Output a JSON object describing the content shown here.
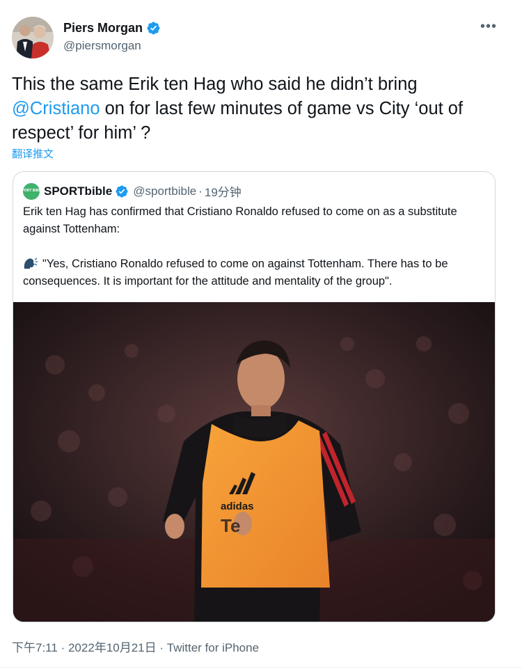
{
  "author": {
    "name": "Piers Morgan",
    "handle": "@piersmorgan",
    "verified": true,
    "avatar_icon": "avatar-photo"
  },
  "tweet": {
    "text_before": "This the same Erik ten Hag who said he didn’t bring ",
    "mention": "@Cristiano",
    "text_after": " on for last few minutes of game vs City ‘out of respect’ for him’ ?",
    "translate_label": "翻译推文"
  },
  "quoted": {
    "name": "SPORTbible",
    "handle": "@sportbible",
    "separator": "·",
    "time": "19分钟",
    "avatar_text": "SPORT BIBLE",
    "paragraph1": "Erik ten Hag has confirmed that Cristiano Ronaldo refused to come on as a substitute against Tottenham:",
    "paragraph2": "\"Yes, Cristiano Ronaldo refused to come on against Tottenham. There has to be consequences. It is important for the attitude and mentality of the group\".",
    "image_bib_text": "adidas",
    "image_shirt_text": "Te"
  },
  "footer": {
    "time": "下午7:11",
    "date": "2022年10月21日",
    "sep": "·",
    "source": "Twitter for iPhone"
  },
  "colors": {
    "accent": "#1d9bf0",
    "text": "#0f1419",
    "secondary": "#536471",
    "border": "#cfd9de"
  }
}
